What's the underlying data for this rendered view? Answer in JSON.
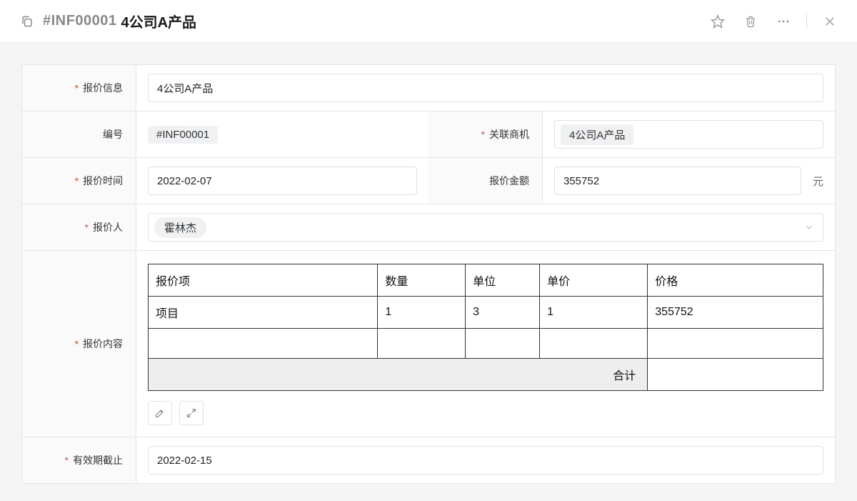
{
  "header": {
    "id": "#INF00001",
    "title": "4公司A产品"
  },
  "form": {
    "quote_info": {
      "label": "报价信息",
      "value": "4公司A产品"
    },
    "code": {
      "label": "编号",
      "value": "#INF00001"
    },
    "opportunity": {
      "label": "关联商机",
      "value": "4公司A产品"
    },
    "quote_date": {
      "label": "报价时间",
      "value": "2022-02-07"
    },
    "amount": {
      "label": "报价金额",
      "value": "355752",
      "suffix": "元"
    },
    "quoter": {
      "label": "报价人",
      "value": "霍林杰"
    },
    "content": {
      "label": "报价内容"
    },
    "valid_until": {
      "label": "有效期截止",
      "value": "2022-02-15"
    }
  },
  "items_table": {
    "headers": {
      "name": "报价项",
      "qty": "数量",
      "unit": "单位",
      "price": "单价",
      "total": "价格"
    },
    "rows": [
      {
        "name": "项目",
        "qty": "1",
        "unit": "3",
        "price": "1",
        "total": "355752"
      },
      {
        "name": "",
        "qty": "",
        "unit": "",
        "price": "",
        "total": ""
      }
    ],
    "sum_label": "合计",
    "sum_value": ""
  }
}
